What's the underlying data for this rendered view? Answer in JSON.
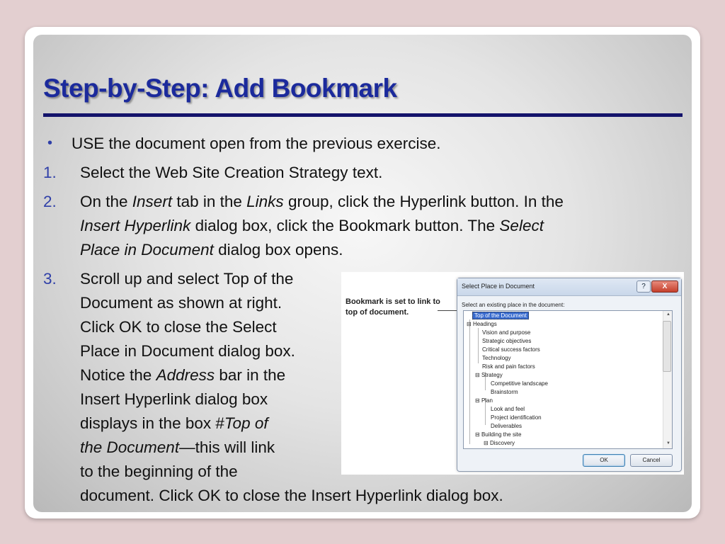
{
  "slide": {
    "title": "Step-by-Step: Add Bookmark",
    "bullet": {
      "marker": "•",
      "bold": "USE",
      "rest": " the document open from the previous exercise."
    },
    "steps": [
      {
        "number": "1.",
        "l1_a": "Select the ",
        "l1_b": "Web Site Creation Strategy",
        "l1_c": " text."
      },
      {
        "number": "2.",
        "l1_a": "On the ",
        "l1_b": "Insert",
        "l1_c": " tab in the ",
        "l1_d": "Links",
        "l1_e": " group, click the ",
        "l1_f": "Hyperlink",
        "l1_g": " button. In the",
        "l2_a": "Insert Hyperlink",
        "l2_b": " dialog box, click the ",
        "l2_c": "Bookmark",
        "l2_d": " button. The ",
        "l2_e": "Select",
        "l3_a": "Place in Document",
        "l3_b": " dialog box opens."
      },
      {
        "number": "3.",
        "l1_a": "Scroll up and select ",
        "l1_b": "Top of the",
        "l2_a": "Document",
        "l2_b": " as shown at right.",
        "l3_a": "Click ",
        "l3_b": "OK",
        "l3_c": " to close the Select",
        "l4": "Place in Document dialog box.",
        "l5_a": "Notice the ",
        "l5_b": "Address",
        "l5_c": " bar in the",
        "l6": "Insert Hyperlink dialog box",
        "l7_a": "displays in the box #",
        "l7_b": "Top of",
        "l8_a": "the Document",
        "l8_b": "—this will link",
        "l9": "to the beginning of the",
        "l10_a": "document. Click ",
        "l10_b": "OK",
        "l10_c": " to close the Insert Hyperlink dialog box."
      }
    ]
  },
  "screenshot": {
    "callout": "Bookmark is set to link to top of document.",
    "dialog_title": "Select Place in Document",
    "help_glyph": "?",
    "close_glyph": "X",
    "label": "Select an existing place in the document:",
    "tree_items": [
      "Top of the Document",
      "Headings",
      "Vision and purpose",
      "Strategic objectives",
      "Critical success factors",
      "Technology",
      "Risk and pain factors",
      "Strategy",
      "Competitive landscape",
      "Brainstorm",
      "Plan",
      "Look and feel",
      "Project identification",
      "Deliverables",
      "Building the site",
      "Discovery"
    ],
    "ok_label": "OK",
    "cancel_label": "Cancel"
  }
}
